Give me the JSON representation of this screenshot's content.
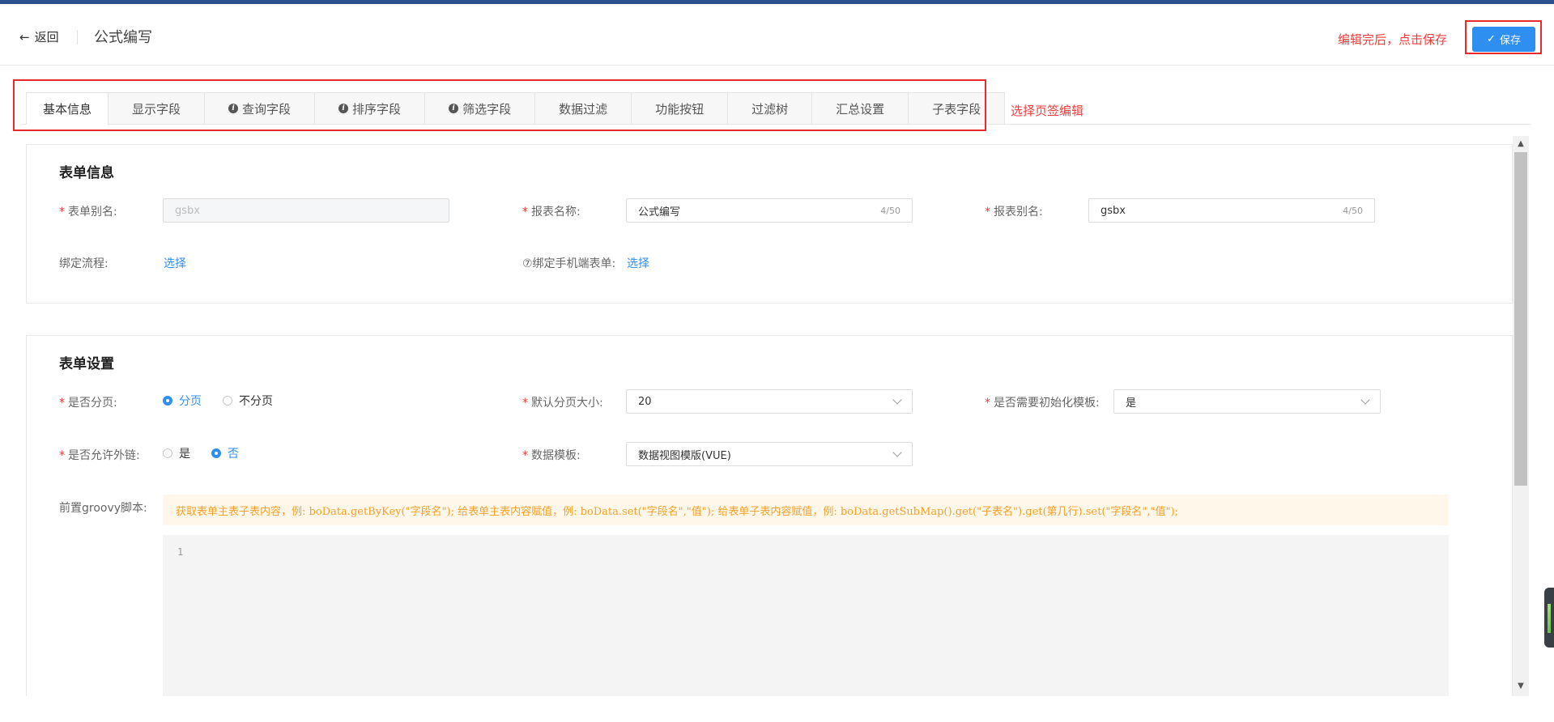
{
  "header": {
    "back_label": "返回",
    "page_title": "公式编写",
    "save_hint": "编辑完后，点击保存",
    "save_label": "保存"
  },
  "tabs": {
    "items": [
      {
        "label": "基本信息",
        "active": true,
        "info": false
      },
      {
        "label": "显示字段",
        "active": false,
        "info": false
      },
      {
        "label": "查询字段",
        "active": false,
        "info": true
      },
      {
        "label": "排序字段",
        "active": false,
        "info": true
      },
      {
        "label": "筛选字段",
        "active": false,
        "info": true
      },
      {
        "label": "数据过滤",
        "active": false,
        "info": false
      },
      {
        "label": "功能按钮",
        "active": false,
        "info": false
      },
      {
        "label": "过滤树",
        "active": false,
        "info": false
      },
      {
        "label": "汇总设置",
        "active": false,
        "info": false
      },
      {
        "label": "子表字段",
        "active": false,
        "info": false
      }
    ],
    "hint": "选择页签编辑"
  },
  "form_info": {
    "title": "表单信息",
    "form_alias_label": "表单别名:",
    "form_alias_value": "gsbx",
    "report_name_label": "报表名称:",
    "report_name_value": "公式编写",
    "report_name_counter": "4/50",
    "report_alias_label": "报表别名:",
    "report_alias_value": "gsbx",
    "report_alias_counter": "4/50",
    "bind_flow_label": "绑定流程:",
    "bind_flow_link": "选择",
    "bind_mobile_label": "⑦绑定手机端表单:",
    "bind_mobile_link": "选择"
  },
  "form_settings": {
    "title": "表单设置",
    "paging_label": "是否分页:",
    "paging_options": [
      "分页",
      "不分页"
    ],
    "paging_selected": "分页",
    "page_size_label": "默认分页大小:",
    "page_size_value": "20",
    "init_template_label": "是否需要初始化模板:",
    "init_template_value": "是",
    "external_link_label": "是否允许外链:",
    "external_link_options": [
      "是",
      "否"
    ],
    "external_link_selected": "否",
    "data_template_label": "数据模板:",
    "data_template_value": "数据视图模版(VUE)",
    "groovy_label": "前置groovy脚本:",
    "groovy_tip": "获取表单主表子表内容，例: boData.getByKey(\"字段名\"); 给表单主表内容赋值，例: boData.set(\"字段名\",\"值\"); 给表单子表内容赋值，例: boData.getSubMap().get(\"子表名\").get(第几行).set(\"字段名\",\"值\");",
    "editor_line": "1"
  },
  "colors": {
    "accent": "#2f8ff0",
    "annotation": "#ea2a2a",
    "required": "#f23b3b",
    "tip_text": "#f5a128"
  }
}
